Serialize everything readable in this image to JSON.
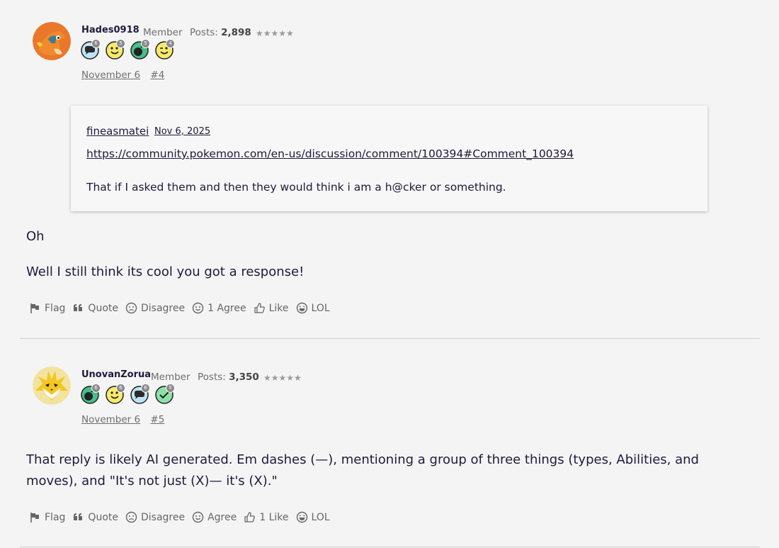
{
  "posts": [
    {
      "author": "Hades0918",
      "role": "Member",
      "posts_label": "Posts:",
      "posts_count": "2,898",
      "stars": "★★★★★",
      "avatar_icon": "charizard-avatar",
      "badges": [
        {
          "icon": "comment-badge-icon",
          "count": "6"
        },
        {
          "icon": "smile-badge-icon",
          "count": "5"
        },
        {
          "icon": "bomb-badge-icon",
          "count": "5"
        },
        {
          "icon": "wink-badge-icon",
          "count": "4"
        }
      ],
      "date": "November 6",
      "permalink": "#4",
      "quote": {
        "author": "fineasmatei",
        "date": "Nov 6, 2025",
        "link": "https://community.pokemon.com/en-us/discussion/comment/100394#Comment_100394",
        "text": "That if I asked them and then they would think i am a h@cker or something."
      },
      "body": [
        "Oh",
        "Well I still think its cool you got a response!"
      ],
      "actions": {
        "flag": "Flag",
        "quote": "Quote",
        "disagree": "Disagree",
        "agree": "1 Agree",
        "like": "Like",
        "lol": "LOL"
      }
    },
    {
      "author": "UnovanZorua",
      "role": "Member",
      "posts_label": "Posts:",
      "posts_count": "3,350",
      "stars": "★★★★★",
      "avatar_icon": "jolteon-avatar",
      "badges": [
        {
          "icon": "bomb-badge-icon",
          "count": "6"
        },
        {
          "icon": "smile-badge-icon",
          "count": "6"
        },
        {
          "icon": "comment-badge-icon",
          "count": "6"
        },
        {
          "icon": "check-badge-icon",
          "count": "5"
        }
      ],
      "date": "November 6",
      "permalink": "#5",
      "body": [
        "That reply is likely AI generated. Em dashes (—), mentioning a group of three things (types, Abilities, and moves), and \"It's not just (X)— it's (X).\""
      ],
      "actions": {
        "flag": "Flag",
        "quote": "Quote",
        "disagree": "Disagree",
        "agree": "Agree",
        "like": "1 Like",
        "lol": "LOL"
      }
    }
  ],
  "colors": {
    "background": "#f4f4f4",
    "text": "#1f1a3b",
    "muted": "#6e6e6e",
    "divider": "#cfcfcf"
  }
}
